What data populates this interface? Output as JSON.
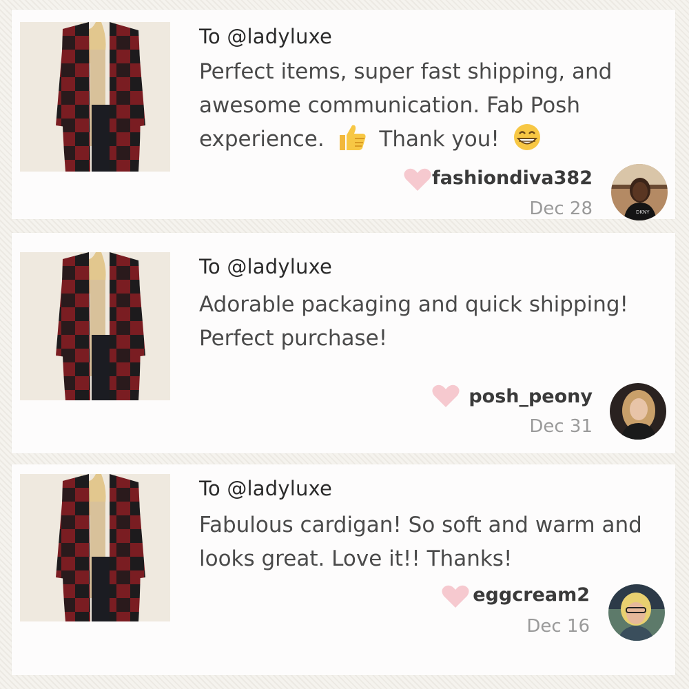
{
  "reviews": [
    {
      "recipient": "To @ladyluxe",
      "message_part1": "Perfect items, super fast shipping, and awesome communication. Fab Posh experience.",
      "emoji1": "thumbs-up-emoji",
      "message_part2": "Thank you!",
      "emoji2": "grinning-face-emoji",
      "username": "fashiondiva382",
      "date": "Dec 28",
      "avatar_icon": "user-avatar"
    },
    {
      "recipient": "To @ladyluxe",
      "message": "Adorable packaging and quick shipping! Perfect purchase!",
      "username": "posh_peony",
      "date": "Dec 31",
      "avatar_icon": "user-avatar"
    },
    {
      "recipient": "To @ladyluxe",
      "message": "Fabulous cardigan! So soft and warm and looks great. Love it!! Thanks!",
      "username": "eggcream2",
      "date": "Dec 16",
      "avatar_icon": "user-avatar"
    }
  ],
  "colors": {
    "heart": "#f6c9cf",
    "card_bg": "#fdfcfc",
    "username": "#3a3a3a",
    "date": "#9a9a9a"
  }
}
